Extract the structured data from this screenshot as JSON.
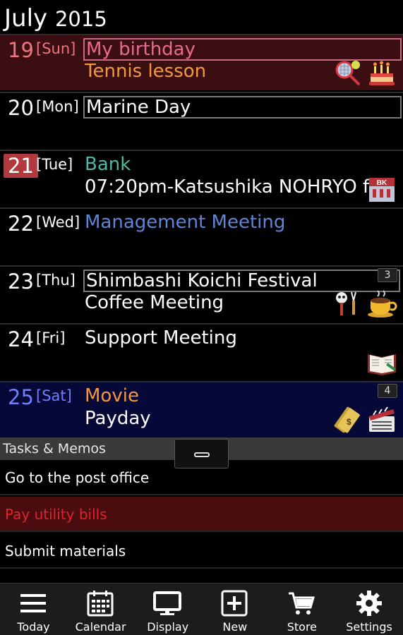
{
  "header": {
    "month": "July",
    "year": "2015"
  },
  "days": [
    {
      "num": "19",
      "weekday": "[Sun]",
      "num_color": "#f0737d",
      "wd_color": "#f0737d",
      "bg": "#3b0f12",
      "events": [
        {
          "text": "My birthday",
          "color": "#e86a92",
          "boxed": true
        },
        {
          "text": "Tennis lesson",
          "color": "#f2983e"
        }
      ],
      "icons": [
        "tennis-icon",
        "birthday-cake-icon"
      ]
    },
    {
      "num": "20",
      "weekday": "[Mon]",
      "num_color": "#ffffff",
      "wd_color": "#ffffff",
      "bg": "#000000",
      "events": [
        {
          "text": "Marine Day",
          "color": "#ffffff",
          "boxed": true
        }
      ],
      "icons": []
    },
    {
      "num": "21",
      "weekday": "[Tue]",
      "num_color": "#ffffff",
      "wd_color": "#ffffff",
      "bg": "#000000",
      "today": true,
      "events": [
        {
          "text": "Bank",
          "color": "#4fb8a4"
        },
        {
          "text": "07:20pm-Katsushika NOHRYO f..",
          "color": "#ffffff"
        }
      ],
      "icons": [
        "bank-icon"
      ]
    },
    {
      "num": "22",
      "weekday": "[Wed]",
      "num_color": "#ffffff",
      "wd_color": "#ffffff",
      "bg": "#000000",
      "events": [
        {
          "text": "Management Meeting",
          "color": "#5f86d6"
        }
      ],
      "icons": []
    },
    {
      "num": "23",
      "weekday": "[Thu]",
      "num_color": "#ffffff",
      "wd_color": "#ffffff",
      "bg": "#000000",
      "events": [
        {
          "text": "Shimbashi Koichi Festival",
          "color": "#ffffff",
          "boxed": true
        },
        {
          "text": "Coffee Meeting",
          "color": "#ffffff"
        }
      ],
      "badge": "3",
      "icons": [
        "festival-icon",
        "coffee-icon"
      ]
    },
    {
      "num": "24",
      "weekday": "[Fri]",
      "num_color": "#ffffff",
      "wd_color": "#ffffff",
      "bg": "#000000",
      "events": [
        {
          "text": "Support Meeting",
          "color": "#ffffff"
        }
      ],
      "icons": [
        "book-icon"
      ]
    },
    {
      "num": "25",
      "weekday": "[Sat]",
      "num_color": "#6f7fff",
      "wd_color": "#6f7fff",
      "bg": "#060838",
      "events": [
        {
          "text": "Movie",
          "color": "#f2983e"
        },
        {
          "text": "Payday",
          "color": "#ffffff"
        }
      ],
      "badge": "4",
      "icons": [
        "money-icon",
        "clapperboard-icon"
      ]
    }
  ],
  "tasks_section": {
    "title": "Tasks & Memos"
  },
  "tasks": [
    {
      "text": "Go to the post office",
      "color": "#ffffff",
      "bg": "#000000"
    },
    {
      "text": "Pay utility bills",
      "color": "#e0242c",
      "bg": "#4a0c0e"
    },
    {
      "text": "Submit materials",
      "color": "#ffffff",
      "bg": "#000000"
    }
  ],
  "nav": [
    {
      "label": "Today",
      "icon": "hamburger-icon"
    },
    {
      "label": "Calendar",
      "icon": "calendar-icon"
    },
    {
      "label": "Display",
      "icon": "monitor-icon"
    },
    {
      "label": "New",
      "icon": "plus-icon"
    },
    {
      "label": "Store",
      "icon": "cart-icon"
    },
    {
      "label": "Settings",
      "icon": "gear-icon"
    }
  ]
}
